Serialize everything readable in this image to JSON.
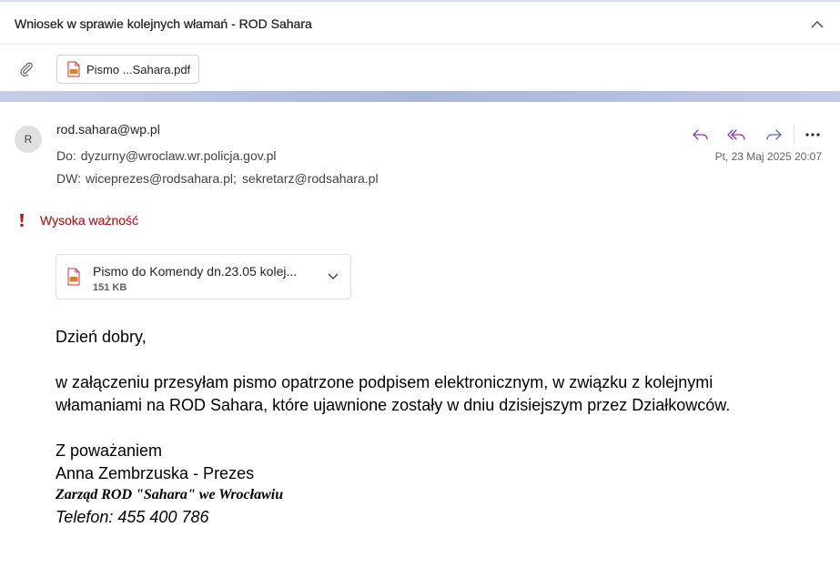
{
  "thread": {
    "title": "Wniosek w sprawie kolejnych włamań - ROD Sahara",
    "attachment_chip_label": "Pismo ...Sahara.pdf"
  },
  "message": {
    "avatar_initial": "R",
    "from": "rod.sahara@wp.pl",
    "to_label": "Do:",
    "to": "dyzurny@wroclaw.wr.policja.gov.pl",
    "cc_label": "DW:",
    "cc": [
      "wiceprezes@rodsahara.pl;",
      "sekretarz@rodsahara.pl"
    ],
    "date": "Pt, 23 Maj 2025 20:07",
    "importance_label": "Wysoka ważność",
    "attachment": {
      "name": "Pismo do Komendy dn.23.05 kolej...",
      "size": "151 KB"
    },
    "body": {
      "greeting": "Dzień dobry,",
      "line1": "w załączeniu przesyłam pismo opatrzone podpisem elektronicznym, w związku z kolejnymi",
      "line2": "włamaniami na ROD Sahara, które ujawnione zostały w dniu dzisiejszym przez Działkowców.",
      "closing": "Z poważaniem",
      "signature_name": "Anna Zembrzuska - Prezes",
      "signature_org": "Zarząd ROD \"Sahara\" we Wrocławiu",
      "signature_phone": "Telefon: 455 400 786"
    }
  },
  "icons": {
    "reply": "reply-icon",
    "reply_all": "reply-all-icon",
    "forward": "forward-icon",
    "more": "more-icon",
    "attachment": "paperclip-icon",
    "pdf": "pdf-file-icon",
    "importance": "exclamation-icon",
    "collapse": "chevron-up-icon",
    "expand": "chevron-down-icon"
  },
  "colors": {
    "accent_purple": "#8a3aa5",
    "forward_blue": "#5b6fb8",
    "importance_red": "#a4262c",
    "band": "#a8b6da"
  }
}
